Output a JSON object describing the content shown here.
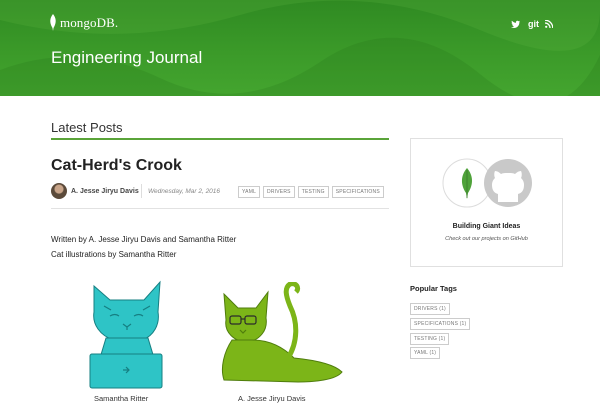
{
  "header": {
    "logo_text": "mongoDB.",
    "site_title": "Engineering Journal",
    "social": [
      {
        "icon": "twitter-icon"
      },
      {
        "label": "git"
      },
      {
        "icon": "rss-icon"
      }
    ],
    "bg_color": "#3b9a29"
  },
  "main": {
    "section_title": "Latest Posts",
    "post": {
      "title": "Cat-Herd's Crook",
      "author": "A. Jesse Jiryu Davis",
      "date": "Wednesday, Mar 2, 2016",
      "tags": [
        "YAML",
        "DRIVERS",
        "TESTING",
        "SPECIFICATIONS"
      ],
      "body_lines": [
        "Written by A. Jesse Jiryu Davis and Samantha Ritter",
        "Cat illustrations by Samantha Ritter"
      ],
      "illustrations": [
        {
          "caption": "Samantha Ritter",
          "color": "#2ec4c6"
        },
        {
          "caption": "A. Jesse Jiryu Davis",
          "color": "#7cb518"
        }
      ]
    }
  },
  "sidebar": {
    "card": {
      "title": "Building Giant Ideas",
      "subtitle": "Check out our projects on GitHub"
    },
    "popular_tags_title": "Popular Tags",
    "popular_tags": [
      "DRIVERS (1)",
      "SPECIFICATIONS (1)",
      "TESTING (1)",
      "YAML (1)"
    ]
  },
  "colors": {
    "accent": "#5aa439",
    "mongo_green": "#4fa23a"
  }
}
